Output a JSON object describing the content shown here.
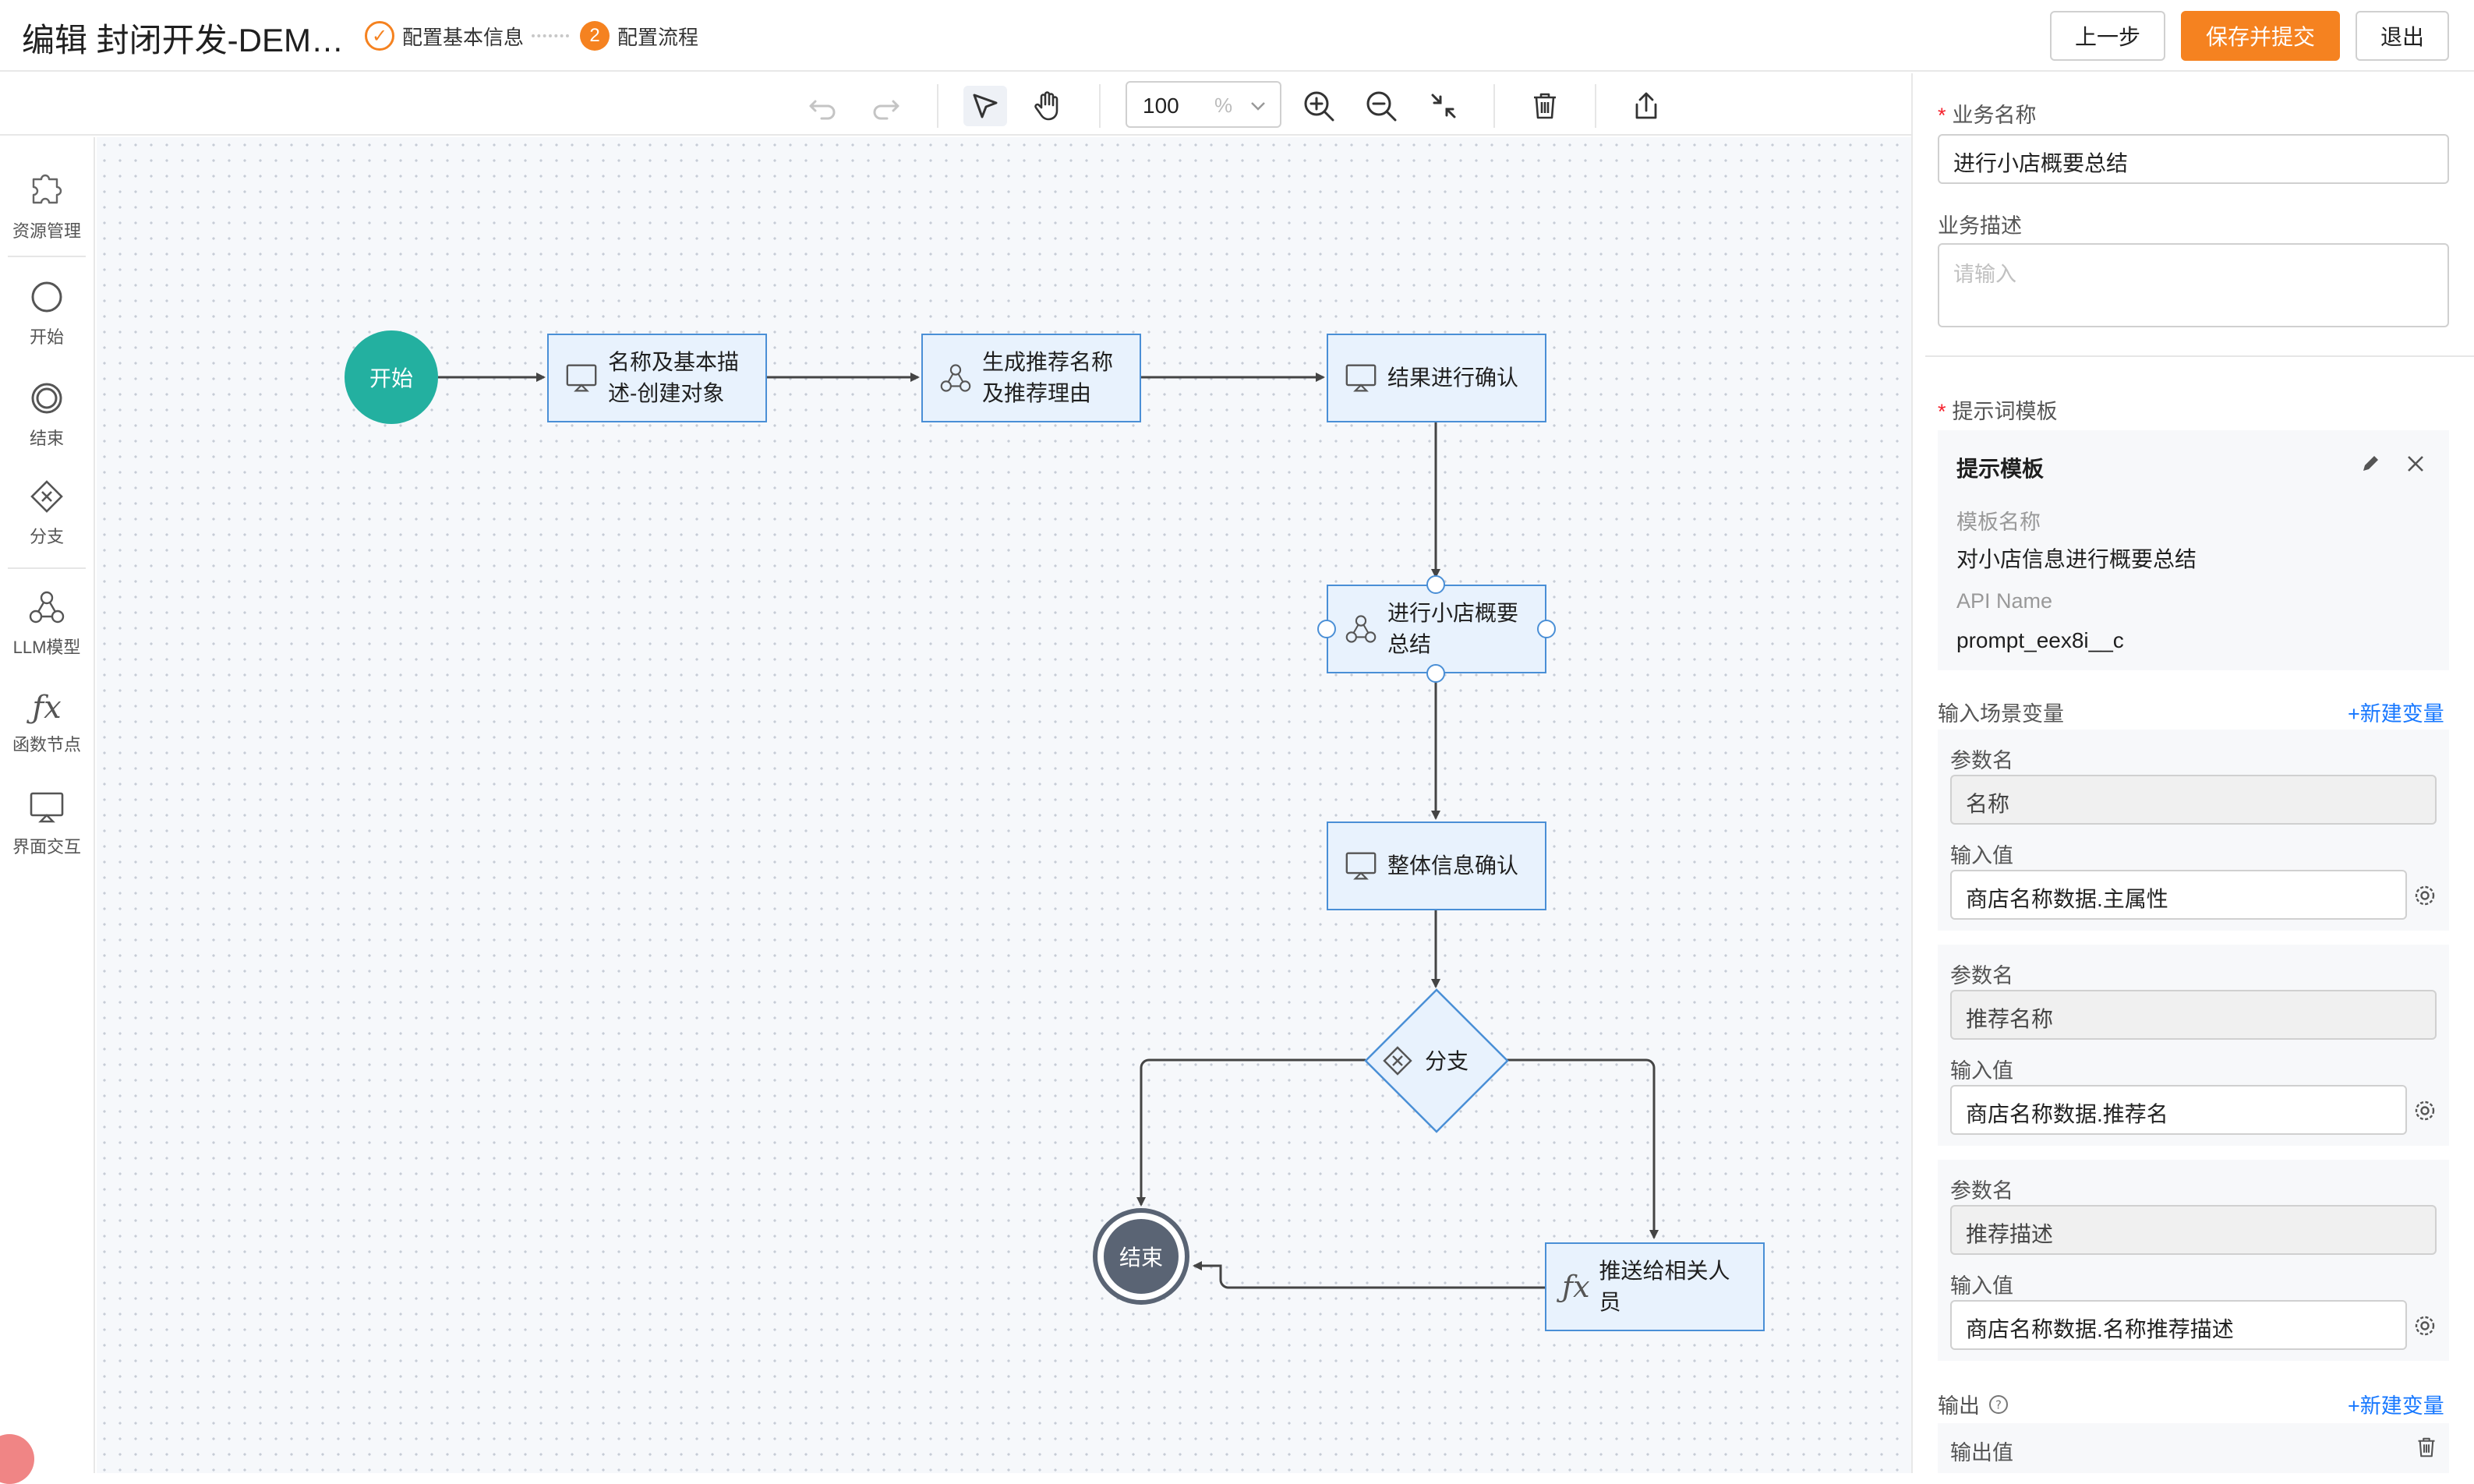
{
  "header": {
    "title": "编辑 封闭开发-DEM…",
    "step1_label": "配置基本信息",
    "step2_num": "2",
    "step2_label": "配置流程",
    "prev_button": "上一步",
    "save_button": "保存并提交",
    "exit_button": "退出"
  },
  "toolbar": {
    "zoom_value": "100",
    "zoom_unit": "%"
  },
  "left_panel": {
    "items": [
      {
        "label": "资源管理",
        "icon": "puzzle-icon"
      },
      {
        "label": "开始",
        "icon": "circle-icon"
      },
      {
        "label": "结束",
        "icon": "double-circle-icon"
      },
      {
        "label": "分支",
        "icon": "diamond-x-icon"
      },
      {
        "label": "LLM模型",
        "icon": "llm-icon"
      },
      {
        "label": "函数节点",
        "icon": "fx-icon"
      },
      {
        "label": "界面交互",
        "icon": "monitor-icon"
      }
    ]
  },
  "flow": {
    "start": "开始",
    "node1_line1": "名称及基本描",
    "node1_line2": "述-创建对象",
    "node2_line1": "生成推荐名称",
    "node2_line2": "及推荐理由",
    "node3": "结果进行确认",
    "node4_line1": "进行小店概要",
    "node4_line2": "总结",
    "node5": "整体信息确认",
    "branch": "分支",
    "node6_line1": "推送给相关人",
    "node6_line2": "员",
    "end": "结束"
  },
  "right_panel": {
    "biz_name_label": "业务名称",
    "biz_name_value": "进行小店概要总结",
    "biz_desc_label": "业务描述",
    "biz_desc_placeholder": "请输入",
    "prompt_template_label": "提示词模板",
    "template_card_title": "提示模板",
    "template_name_label": "模板名称",
    "template_name_value": "对小店信息进行概要总结",
    "api_name_label": "API Name",
    "api_name_value": "prompt_eex8i__c",
    "input_vars_label": "输入场景变量",
    "add_var_link": "+新建变量",
    "params": [
      {
        "name_label": "参数名",
        "name_value": "名称",
        "input_label": "输入值",
        "input_value": "商店名称数据.主属性"
      },
      {
        "name_label": "参数名",
        "name_value": "推荐名称",
        "input_label": "输入值",
        "input_value": "商店名称数据.推荐名"
      },
      {
        "name_label": "参数名",
        "name_value": "推荐描述",
        "input_label": "输入值",
        "input_value": "商店名称数据.名称推荐描述"
      }
    ],
    "output_label": "输出",
    "output_add_link": "+新建变量",
    "output_value_label": "输出值"
  },
  "colors": {
    "accent": "#f58220",
    "node_fill": "#e8f2fd",
    "node_border": "#4a8fd6",
    "start_fill": "#23b0a0",
    "end_fill": "#5a6474",
    "link": "#1677ff"
  }
}
